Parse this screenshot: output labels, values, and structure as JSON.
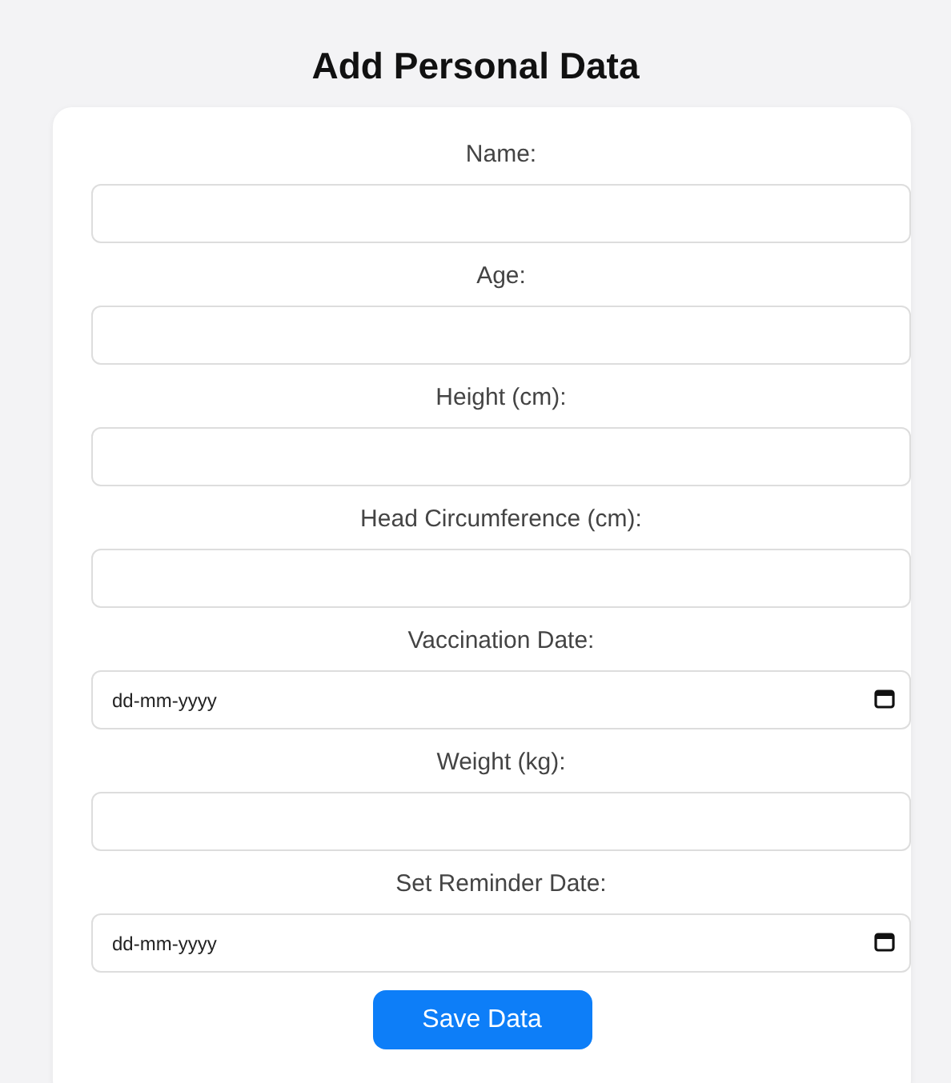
{
  "title": "Add Personal Data",
  "fields": [
    {
      "label": "Name:",
      "kind": "text"
    },
    {
      "label": "Age:",
      "kind": "text"
    },
    {
      "label": "Height (cm):",
      "kind": "text"
    },
    {
      "label": "Head Circumference (cm):",
      "kind": "text"
    },
    {
      "label": "Vaccination Date:",
      "kind": "date",
      "placeholder": "dd-mm-yyyy"
    },
    {
      "label": "Weight (kg):",
      "kind": "text"
    },
    {
      "label": "Set Reminder Date:",
      "kind": "date",
      "placeholder": "dd-mm-yyyy"
    }
  ],
  "button": "Save Data"
}
